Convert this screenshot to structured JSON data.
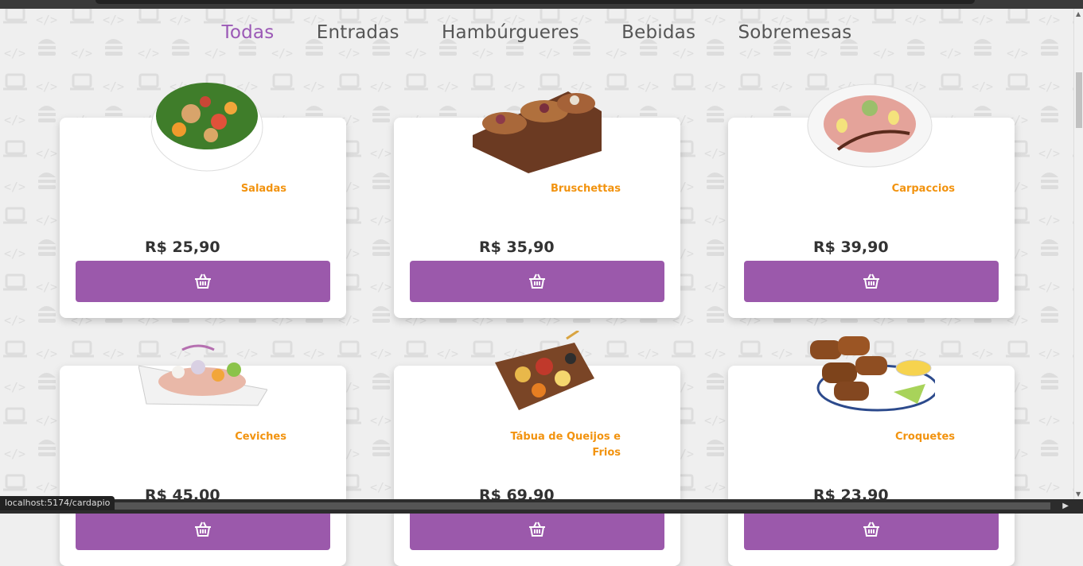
{
  "nav": {
    "items": [
      "Todas",
      "Entradas",
      "Hambúrgueres",
      "Bebidas",
      "Sobremesas"
    ],
    "active": "Todas"
  },
  "products": [
    {
      "name": "Saladas",
      "price": "R$ 25,90",
      "image": "salad-bowl"
    },
    {
      "name": "Bruschettas",
      "price": "R$ 35,90",
      "image": "bruschetta-board"
    },
    {
      "name": "Carpaccios",
      "price": "R$ 39,90",
      "image": "carpaccio-plate"
    },
    {
      "name": "Ceviches",
      "price": "R$ 45,00",
      "image": "ceviche-plate"
    },
    {
      "name": "Tábua de Queijos e Frios",
      "price": "R$ 69,90",
      "image": "cheese-board"
    },
    {
      "name": "Croquetes",
      "price": "R$ 23,90",
      "image": "croquettes-plate"
    }
  ],
  "cart_icon": "basket-icon",
  "status_url": "localhost:5174/cardapio",
  "colors": {
    "accent": "#9b59ab",
    "title": "#f2930f",
    "active_nav": "#9b59b6"
  }
}
